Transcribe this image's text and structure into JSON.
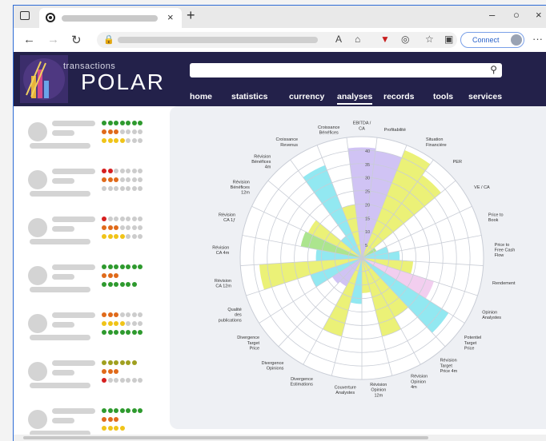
{
  "browser": {
    "connect_label": "Connect"
  },
  "site": {
    "logo_small": "transactions",
    "logo_big": "POLAR",
    "menu": [
      "home",
      "statistics",
      "currency",
      "analyses",
      "records",
      "tools",
      "services"
    ],
    "active_menu": "analyses"
  },
  "list_rows": [
    {
      "dots": [
        [
          "#2e9a2e",
          7
        ]
      ],
      "dots2": [
        [
          "#e06a1a",
          3
        ],
        [
          "#cccccc",
          4
        ]
      ],
      "dots3": [
        [
          "#f0c418",
          4
        ],
        [
          "#cccccc",
          3
        ]
      ]
    },
    {
      "dots": [
        [
          "#d61f1f",
          2
        ],
        [
          "#cccccc",
          5
        ]
      ],
      "dots2": [
        [
          "#e06a1a",
          3
        ],
        [
          "#cccccc",
          4
        ]
      ],
      "dots3": [
        [
          "#cccccc",
          7
        ]
      ]
    },
    {
      "dots": [
        [
          "#d61f1f",
          1
        ],
        [
          "#cccccc",
          6
        ]
      ],
      "dots2": [
        [
          "#e06a1a",
          3
        ],
        [
          "#cccccc",
          4
        ]
      ],
      "dots3": [
        [
          "#f0c418",
          4
        ],
        [
          "#cccccc",
          3
        ]
      ]
    },
    {
      "dots": [
        [
          "#2e9a2e",
          7
        ]
      ],
      "dots2": [
        [
          "#e06a1a",
          3
        ]
      ],
      "dots3": [
        [
          "#2e9a2e",
          6
        ]
      ]
    },
    {
      "dots": [
        [
          "#e06a1a",
          3
        ],
        [
          "#cccccc",
          4
        ]
      ],
      "dots2": [
        [
          "#f0c418",
          4
        ],
        [
          "#cccccc",
          3
        ]
      ],
      "dots3": [
        [
          "#2e9a2e",
          7
        ]
      ]
    },
    {
      "dots": [
        [
          "#a0a020",
          6
        ]
      ],
      "dots2": [
        [
          "#e06a1a",
          3
        ]
      ],
      "dots3": [
        [
          "#d61f1f",
          1
        ],
        [
          "#cccccc",
          6
        ]
      ]
    },
    {
      "dots": [
        [
          "#2e9a2e",
          7
        ]
      ],
      "dots2": [
        [
          "#e06a1a",
          3
        ]
      ],
      "dots3": [
        [
          "#f0c418",
          4
        ]
      ]
    }
  ],
  "chart_data": {
    "type": "polar-area",
    "r_ticks": [
      5,
      10,
      15,
      20,
      25,
      30,
      35,
      40
    ],
    "r_max": 45,
    "colors": {
      "yellow": "#e8ef5f",
      "cyan": "#7fe4ee",
      "lavender": "#c8b8f2",
      "green": "#9de07a",
      "pink": "#f0c6ec"
    },
    "categories": [
      {
        "label": "EBITDA /\nCA",
        "value": 41,
        "color": "lavender"
      },
      {
        "label": "Profitabilité",
        "value": 40,
        "color": "lavender"
      },
      {
        "label": "Situation\nFinancière",
        "value": 43,
        "color": "yellow"
      },
      {
        "label": "PER",
        "value": 38,
        "color": "yellow"
      },
      {
        "label": "VE / CA",
        "value": 6,
        "color": "green"
      },
      {
        "label": "Price to\nBook",
        "value": 10,
        "color": "cyan"
      },
      {
        "label": "Price to\nFree Cash\nFlow",
        "value": 14,
        "color": "cyan"
      },
      {
        "label": "Rendement",
        "value": 19,
        "color": "yellow"
      },
      {
        "label": "Opinion\nAnalystes",
        "value": 28,
        "color": "pink"
      },
      {
        "label": "Potentiel\nTarget\nPrice",
        "value": 38,
        "color": "cyan"
      },
      {
        "label": "Révision\nTarget\nPrice 4m",
        "value": 25,
        "color": "yellow"
      },
      {
        "label": "Révision\nOpinion\n4m",
        "value": 30,
        "color": "yellow"
      },
      {
        "label": "Révision\nOpinion\n12m",
        "value": 13,
        "color": "yellow"
      },
      {
        "label": "Couverture\nAnalystes",
        "value": 17,
        "color": "cyan"
      },
      {
        "label": "Divergence\nEstimations",
        "value": 30,
        "color": "yellow"
      },
      {
        "label": "Divergence\nOpinions",
        "value": 12,
        "color": "lavender"
      },
      {
        "label": "Divergence\nTarget\nPrice",
        "value": 13,
        "color": "lavender"
      },
      {
        "label": "Qualité\ndes\npublications",
        "value": 20,
        "color": "cyan"
      },
      {
        "label": "Révision\nCA 12m",
        "value": 38,
        "color": "yellow"
      },
      {
        "label": "Révision\nCA 4m",
        "value": 17,
        "color": "cyan"
      },
      {
        "label": "Révision\nCA 1ƒ",
        "value": 23,
        "color": "green"
      },
      {
        "label": "Révision\nBénéfices\n12m",
        "value": 22,
        "color": "yellow"
      },
      {
        "label": "Révision\nBénéfices\n4m",
        "value": 10,
        "color": "cyan"
      },
      {
        "label": "Croissance\nRevenus",
        "value": 37,
        "color": "cyan"
      },
      {
        "label": "Croissance\nBénéfices",
        "value": 20,
        "color": "yellow"
      }
    ]
  }
}
